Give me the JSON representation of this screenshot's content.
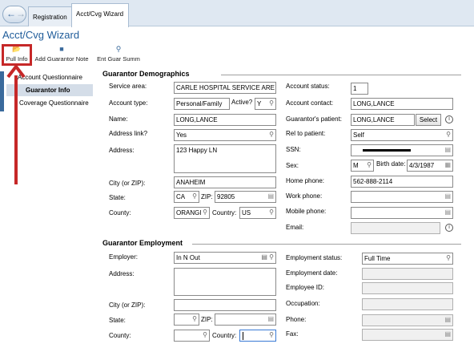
{
  "tabs": [
    {
      "label": "Registration"
    },
    {
      "label": "Acct/Cvg Wizard"
    }
  ],
  "page_title": "Acct/Cvg Wizard",
  "toolbar": {
    "pull_info": "Pull Info",
    "add_guarantor_note": "Add Guarantor Note",
    "ent_guar_summ": "Ent Guar Summ"
  },
  "sidebar": {
    "items": [
      {
        "label": "Account Questionnaire"
      },
      {
        "label": "Guarantor Info"
      },
      {
        "label": "Coverage Questionnaire"
      }
    ]
  },
  "demographics": {
    "heading": "Guarantor Demographics",
    "service_area_label": "Service area:",
    "service_area": "CARLE HOSPITAL SERVICE ARE",
    "account_type_label": "Account type:",
    "account_type": "Personal/Family",
    "active_label": "Active?",
    "active": "Y",
    "name_label": "Name:",
    "name": "LONG,LANCE",
    "address_link_label": "Address link?",
    "address_link": "Yes",
    "address_label": "Address:",
    "address": "123 Happy LN",
    "city_label": "City (or ZIP):",
    "city": "ANAHEIM",
    "state_label": "State:",
    "state": "CA",
    "zip_label": "ZIP:",
    "zip": "92805",
    "county_label": "County:",
    "county": "ORANGI",
    "country_label": "Country:",
    "country": "US",
    "account_status_label": "Account status:",
    "account_status": "1",
    "account_contact_label": "Account contact:",
    "account_contact": "LONG,LANCE",
    "guarantors_patient_label": "Guarantor's patient:",
    "guarantors_patient": "LONG,LANCE",
    "select_label": "Select",
    "rel_to_patient_label": "Rel to patient:",
    "rel_to_patient": "Self",
    "ssn_label": "SSN:",
    "sex_label": "Sex:",
    "sex": "M",
    "birth_date_label": "Birth date:",
    "birth_date": "4/3/1987",
    "home_phone_label": "Home phone:",
    "home_phone": "562-888-2114",
    "work_phone_label": "Work phone:",
    "mobile_phone_label": "Mobile phone:",
    "email_label": "Email:"
  },
  "employment": {
    "heading": "Guarantor Employment",
    "employer_label": "Employer:",
    "employer": "In N Out",
    "address_label": "Address:",
    "city_label": "City (or ZIP):",
    "state_label": "State:",
    "zip_label": "ZIP:",
    "county_label": "County:",
    "country_label": "Country:",
    "employment_status_label": "Employment status:",
    "employment_status": "Full Time",
    "employment_date_label": "Employment date:",
    "employee_id_label": "Employee ID:",
    "occupation_label": "Occupation:",
    "phone_label": "Phone:",
    "fax_label": "Fax:"
  },
  "icons": {
    "magnifier": "search-icon",
    "lookup": "lookup-icon",
    "calendar": "calendar-icon",
    "info": "info-icon"
  },
  "colors": {
    "annotation": "#c62828",
    "title": "#1f5c9a",
    "nav_selected": "#d4dde8"
  }
}
